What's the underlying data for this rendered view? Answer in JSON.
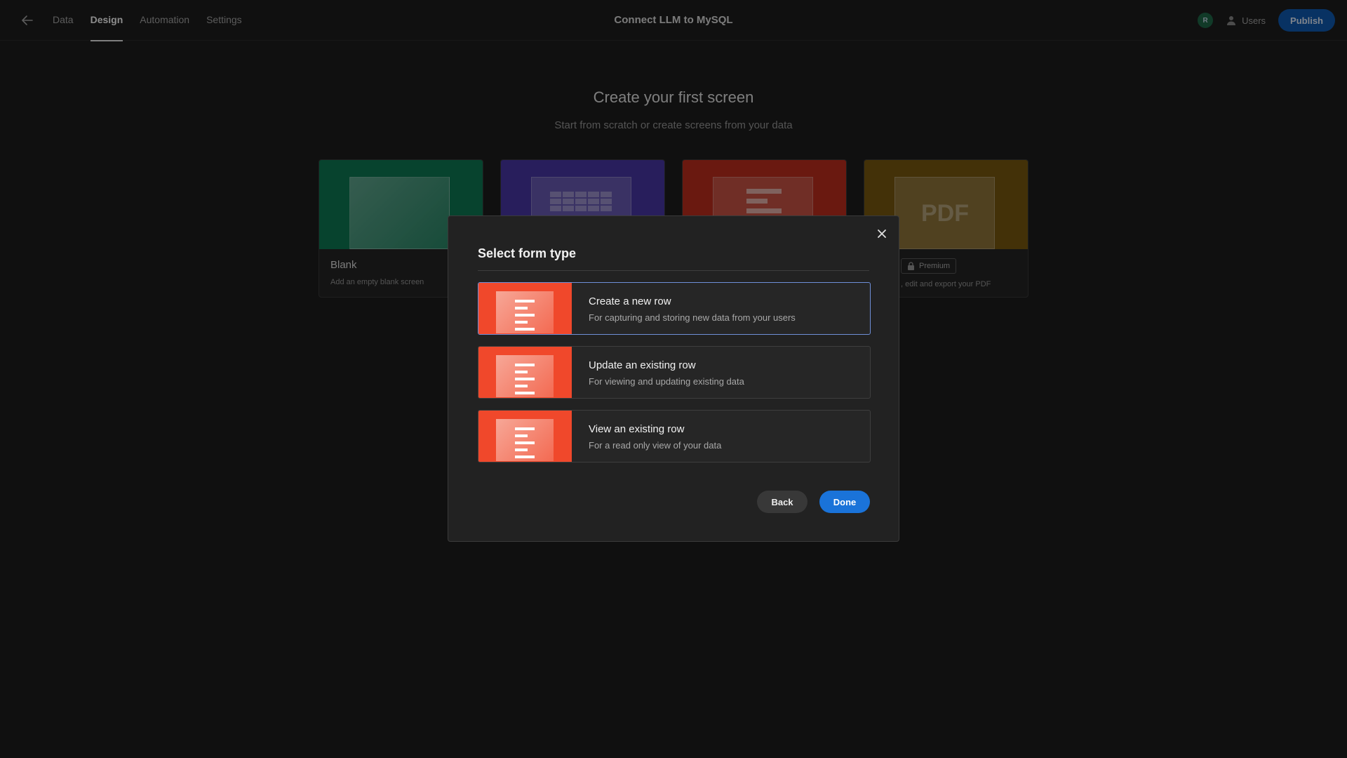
{
  "header": {
    "tabs": [
      {
        "label": "Data"
      },
      {
        "label": "Design",
        "active": true
      },
      {
        "label": "Automation"
      },
      {
        "label": "Settings"
      }
    ],
    "app_title": "Connect LLM to MySQL",
    "avatar_initial": "R",
    "users_label": "Users",
    "publish_label": "Publish"
  },
  "main": {
    "heading": "Create your first screen",
    "subheading": "Start from scratch or create screens from your data",
    "cards": [
      {
        "label": "Blank",
        "desc": "Add an empty blank screen",
        "color": "#0e7a55"
      },
      {
        "label": "",
        "desc": "",
        "color": "#4a38a8"
      },
      {
        "label": "",
        "desc": "",
        "color": "#c22f1e"
      },
      {
        "label": "Premium",
        "desc": ", edit and export your PDF",
        "color": "#7a5a10"
      }
    ]
  },
  "modal": {
    "title": "Select form type",
    "options": [
      {
        "title": "Create a new row",
        "desc": "For capturing and storing new data from your users",
        "selected": true
      },
      {
        "title": "Update an existing row",
        "desc": "For viewing and updating existing data",
        "selected": false
      },
      {
        "title": "View an existing row",
        "desc": "For a read only view of your data",
        "selected": false
      }
    ],
    "back_label": "Back",
    "done_label": "Done"
  },
  "colors": {
    "accent": "#1a73d9",
    "form_thumb": "#f0482b",
    "background": "#1e1e1e"
  }
}
